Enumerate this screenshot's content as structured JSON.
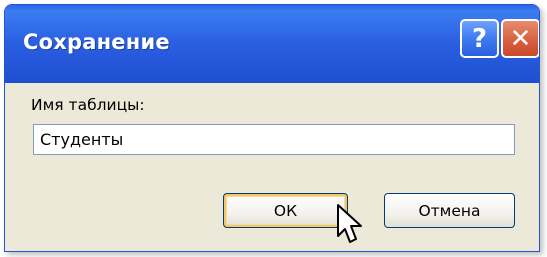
{
  "dialog": {
    "title": "Сохранение",
    "help_button_label": "?",
    "close_button_label": "✕",
    "field_label": "Имя таблицы:",
    "field_value": "Студенты",
    "ok_label": "ОК",
    "cancel_label": "Отмена"
  },
  "colors": {
    "titlebar_blue": "#2a5ee1",
    "body_gray": "#ece9d8",
    "close_red": "#d8613f",
    "ok_focus_ring": "#f4c66b"
  },
  "icons": {
    "help": "help-icon",
    "close": "close-icon",
    "cursor": "mouse-pointer-icon"
  }
}
